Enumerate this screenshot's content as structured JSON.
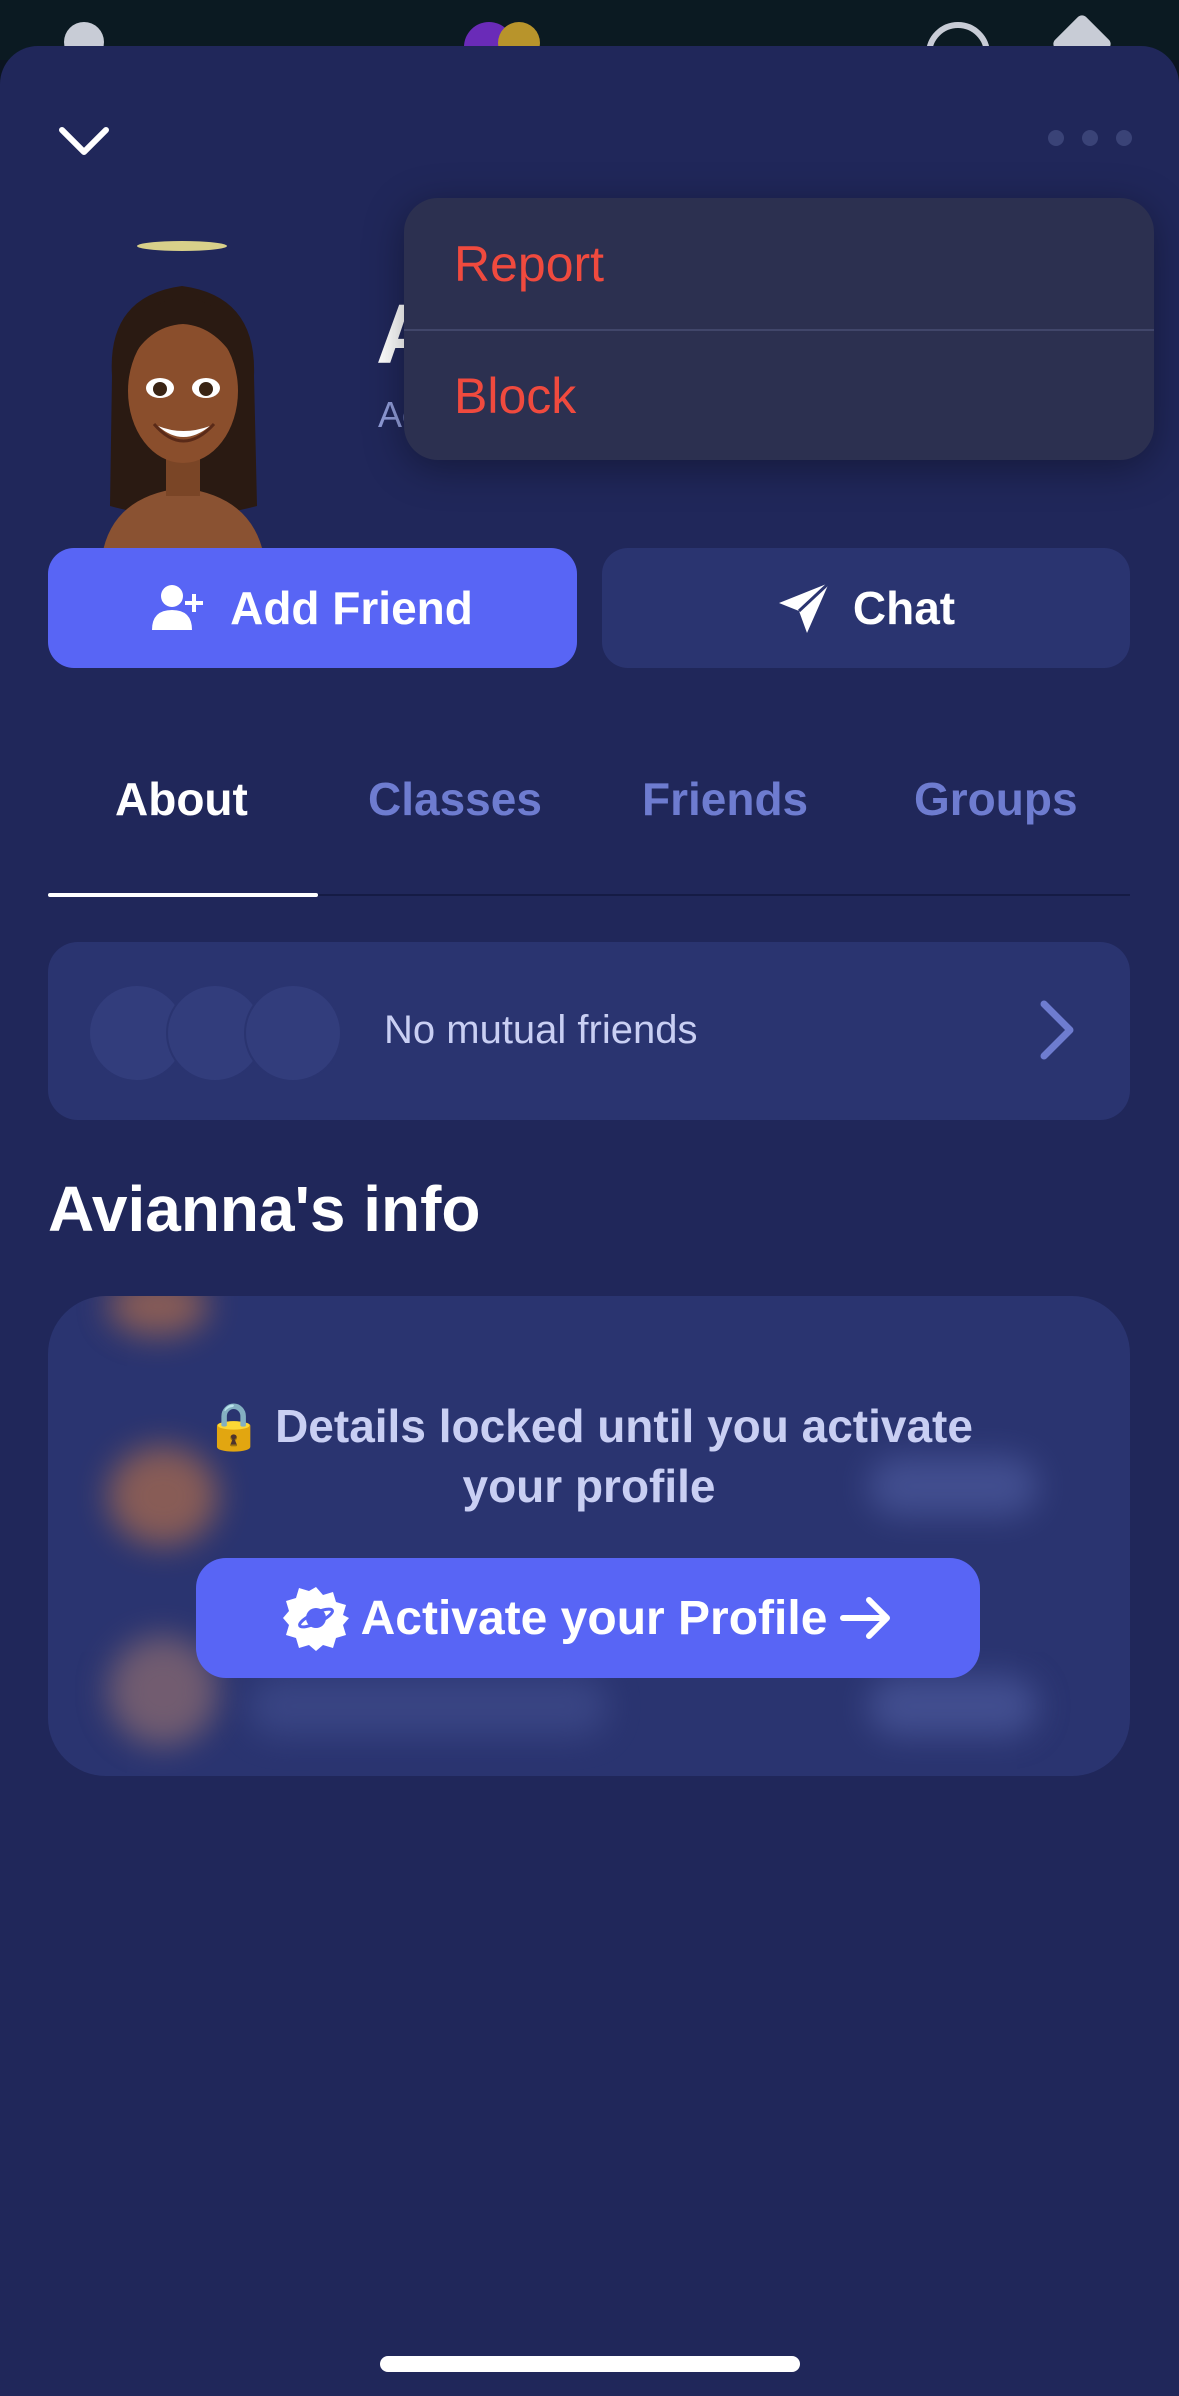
{
  "menu": {
    "report": "Report",
    "block": "Block"
  },
  "profile": {
    "name_visible": "A",
    "handle_visible": "Ac"
  },
  "actions": {
    "add_friend": "Add Friend",
    "chat": "Chat"
  },
  "tabs": [
    {
      "label": "About",
      "active": true
    },
    {
      "label": "Classes",
      "active": false
    },
    {
      "label": "Friends",
      "active": false
    },
    {
      "label": "Groups",
      "active": false
    }
  ],
  "mutual": {
    "label": "No mutual friends"
  },
  "info": {
    "title": "Avianna's info",
    "locked_line1": "🔒 Details locked until you activate",
    "locked_line2": "your profile",
    "activate_label": "Activate your Profile"
  },
  "colors": {
    "sheet_bg": "#20275a",
    "card_bg": "#2a3470",
    "accent": "#5865f5",
    "menu_text": "#f04a3e",
    "tab_inactive": "#6e7cd0"
  },
  "icons": [
    "chevron-down-icon",
    "more-dots-icon",
    "add-user-icon",
    "paper-plane-icon",
    "chevron-right-icon",
    "lock-icon",
    "verified-badge-icon",
    "arrow-right-icon"
  ]
}
